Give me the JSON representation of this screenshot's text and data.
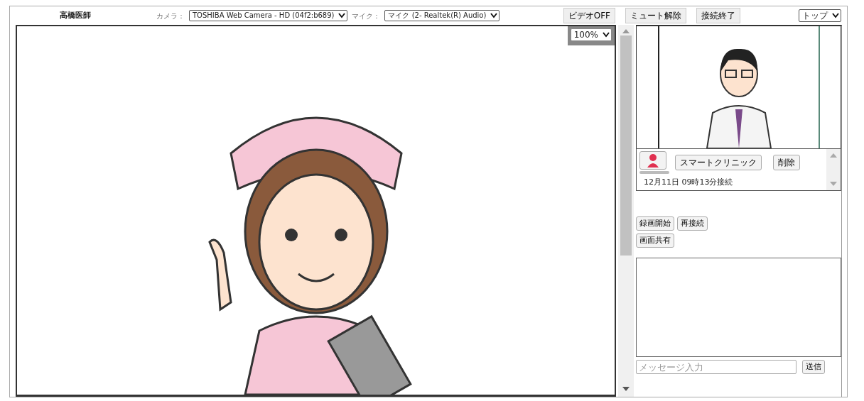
{
  "header": {
    "user_name": "高橋医師",
    "camera_label": "カメラ：",
    "camera_value": "TOSHIBA Web Camera - HD (04f2:b689)",
    "mic_label": "マイク：",
    "mic_value": "マイク (2- Realtek(R) Audio)",
    "buttons": [
      "ビデオOFF",
      "ミュート解除",
      "接続終了"
    ],
    "view_select": "トップ"
  },
  "main_video": {
    "zoom": "100%"
  },
  "participants": [
    {
      "name": "スマートクリニック",
      "delete": "削除",
      "connected": "12月11日 09時13分接続"
    }
  ],
  "actions": [
    "録画開始",
    "再接続",
    "画面共有"
  ],
  "chat": {
    "placeholder": "メッセージ入力",
    "send": "送信"
  }
}
